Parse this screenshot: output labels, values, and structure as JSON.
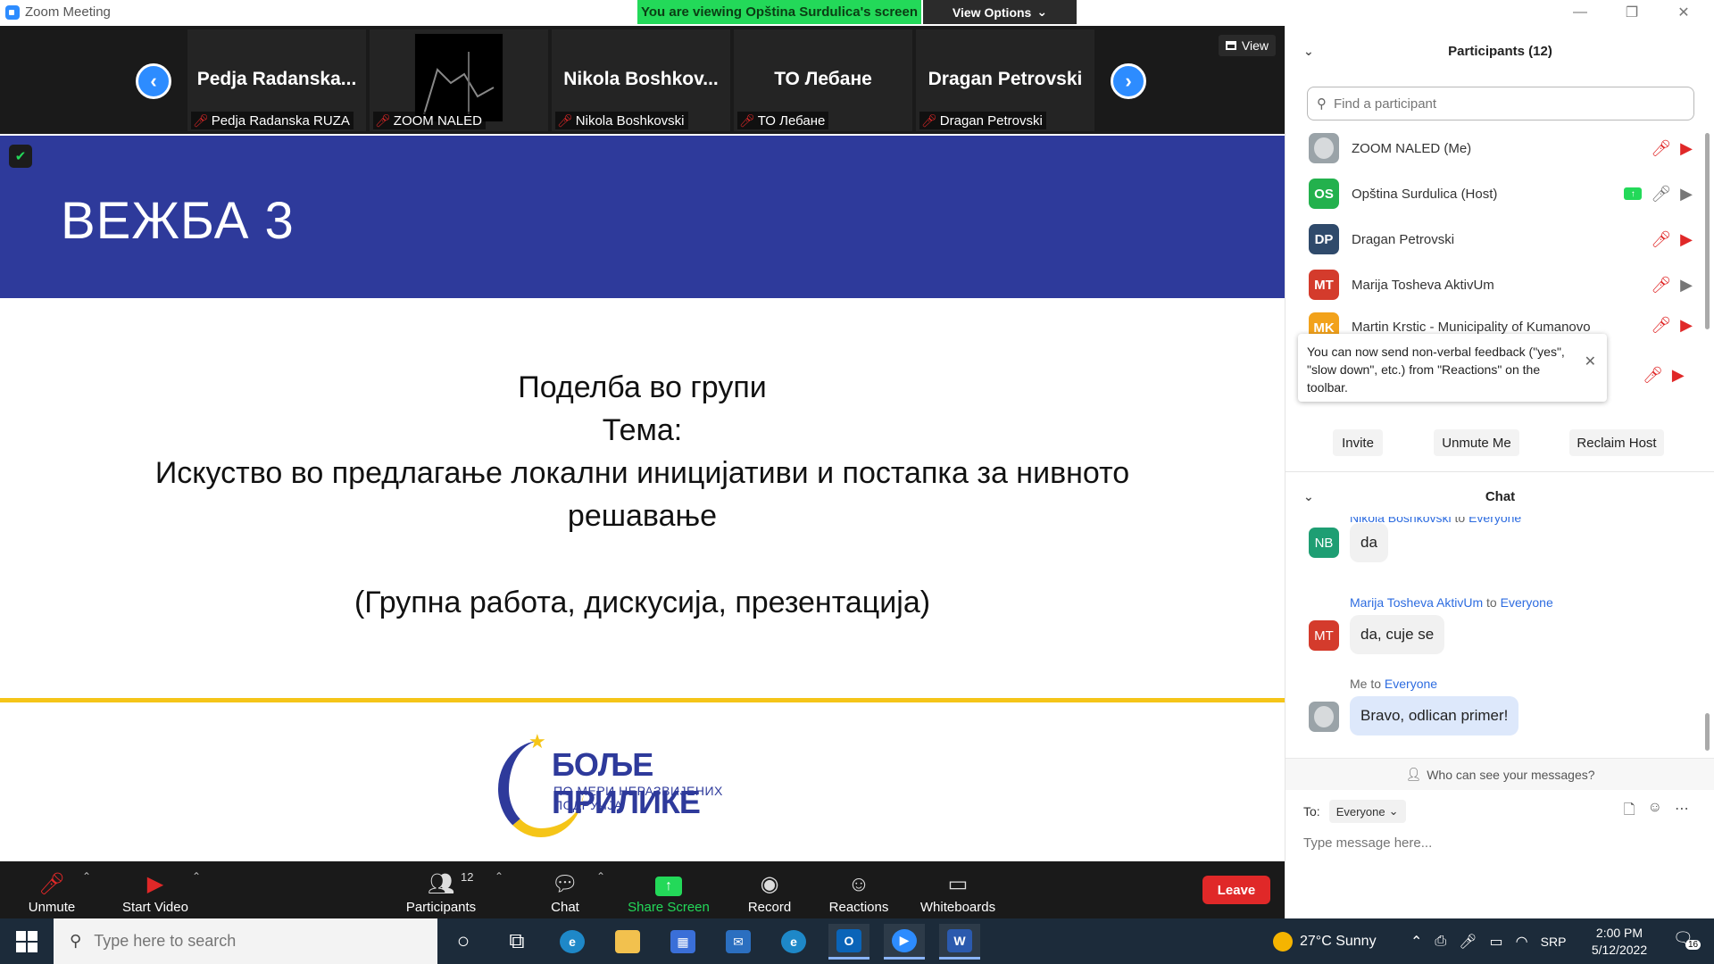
{
  "window": {
    "title": "Zoom Meeting"
  },
  "banner": {
    "viewing": "You are viewing Opština Surdulica's screen",
    "view_options": "View Options"
  },
  "video_strip": {
    "view_label": "View",
    "tiles": [
      {
        "name": "Pedja  Radanska...",
        "label": "Pedja Radanska RUZA"
      },
      {
        "name": "",
        "label": "ZOOM NALED"
      },
      {
        "name": "Nikola  Boshkov...",
        "label": "Nikola Boshkovski"
      },
      {
        "name": "ТО Лебане",
        "label": "ТО Лебане"
      },
      {
        "name": "Dragan Petrovski",
        "label": "Dragan Petrovski"
      }
    ]
  },
  "slide": {
    "title": "ВЕЖБА 3",
    "line1": "Поделба во групи",
    "line2": "Тема:",
    "line3": "Искуство во предлагање локални иницијативи и постапка за нивното",
    "line4": "решавање",
    "subtitle": "(Групна работа, дискусија, презентација)",
    "logo_text": "БОЉЕ ПРИЛИКЕ",
    "logo_sub": "ПО МЕРИ НЕРАЗВИЈЕНИХ ПОДРУЧЈА"
  },
  "toolbar": {
    "unmute": "Unmute",
    "start_video": "Start Video",
    "participants": "Participants",
    "participants_count": "12",
    "chat": "Chat",
    "share_screen": "Share Screen",
    "record": "Record",
    "reactions": "Reactions",
    "whiteboards": "Whiteboards",
    "leave": "Leave"
  },
  "participants": {
    "header": "Participants (12)",
    "search_placeholder": "Find a participant",
    "list": [
      {
        "initials": "",
        "name": "ZOOM NALED (Me)",
        "color": "#9aa3a8"
      },
      {
        "initials": "OS",
        "name": "Opština Surdulica (Host)",
        "color": "#23B14D"
      },
      {
        "initials": "DP",
        "name": "Dragan Petrovski",
        "color": "#2F4A6B"
      },
      {
        "initials": "MT",
        "name": "Marija Tosheva AktivUm",
        "color": "#D43B2C"
      },
      {
        "initials": "MK",
        "name": "Martin Krstic - Municipality of Kumanovo",
        "color": "#F2A21B"
      }
    ],
    "tooltip": "You can now send non-verbal feedback (\"yes\", \"slow down\", etc.) from \"Reactions\" on the toolbar.",
    "invite": "Invite",
    "unmute_me": "Unmute Me",
    "reclaim_host": "Reclaim Host"
  },
  "chat": {
    "header": "Chat",
    "messages": [
      {
        "sender": "Nikola Boshkovski",
        "to_word": "to",
        "recipient": "Everyone",
        "initials": "NB",
        "color": "#1E9E73",
        "text": "da"
      },
      {
        "sender": "Marija Tosheva AktivUm",
        "to_word": "to",
        "recipient": "Everyone",
        "initials": "MT",
        "color": "#D43B2C",
        "text": "da, cuje se"
      },
      {
        "sender": "Me",
        "to_word": "to",
        "recipient": "Everyone",
        "initials": "",
        "color": "#9aa3a8",
        "text": "Bravo, odlican primer!"
      }
    ],
    "who_can_see": "Who can see your messages?",
    "to_label": "To:",
    "to_value": "Everyone",
    "input_placeholder": "Type message here..."
  },
  "taskbar": {
    "search_placeholder": "Type here to search",
    "weather": "27°C  Sunny",
    "lang": "SRP",
    "time": "2:00 PM",
    "date": "5/12/2022",
    "notifications": "16"
  }
}
